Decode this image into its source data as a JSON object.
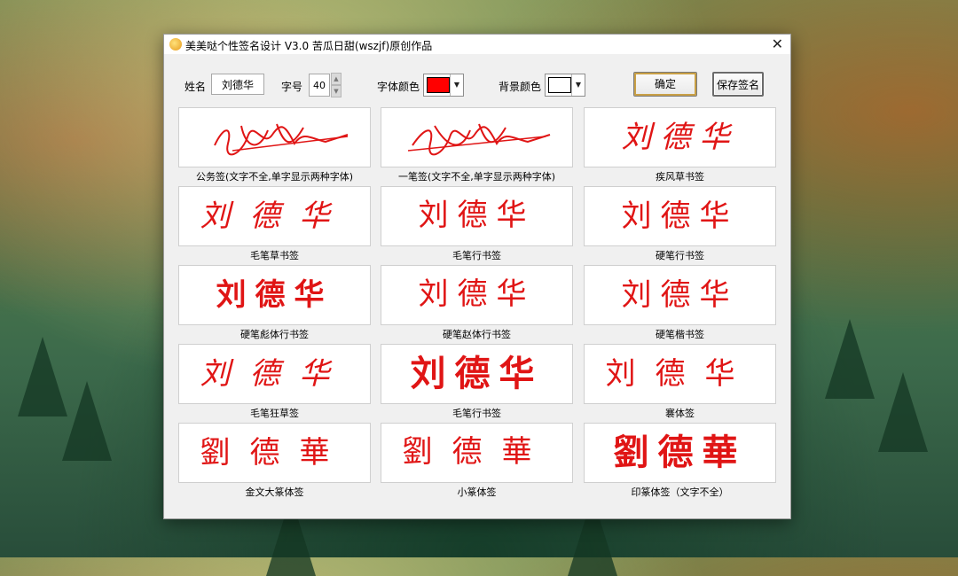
{
  "window": {
    "title": "美美哒个性签名设计 V3.0   苦瓜日甜(wszjf)原创作品",
    "close_glyph": "✕"
  },
  "toolbar": {
    "name_label": "姓名",
    "name_value": "刘德华",
    "size_label": "字号",
    "size_value": "40",
    "font_color_label": "字体颜色",
    "font_color": "#ff0000",
    "bg_color_label": "背景颜色",
    "bg_color": "#ffffff",
    "confirm_button": "确定",
    "save_button": "保存签名"
  },
  "signature_color": "#e01515",
  "panels": [
    {
      "caption": "公务签(文字不全,单字显示两种字体)"
    },
    {
      "caption": "一笔签(文字不全,单字显示两种字体)"
    },
    {
      "caption": "疾风草书签",
      "text": "刘德华"
    },
    {
      "caption": "毛笔草书签",
      "text": "刘德华"
    },
    {
      "caption": "毛笔行书签",
      "text": "刘德华"
    },
    {
      "caption": "硬笔行书签",
      "text": "刘德华"
    },
    {
      "caption": "硬笔彪体行书签",
      "text": "刘德华"
    },
    {
      "caption": "硬笔赵体行书签",
      "text": "刘德华"
    },
    {
      "caption": "硬笔楷书签",
      "text": "刘德华"
    },
    {
      "caption": "毛笔狂草签",
      "text": "刘德华"
    },
    {
      "caption": "毛笔行书签",
      "text": "刘德华"
    },
    {
      "caption": "褰体签",
      "text": "刘德华"
    },
    {
      "caption": "金文大篆体签",
      "text": "劉德華"
    },
    {
      "caption": "小篆体签",
      "text": "劉德華"
    },
    {
      "caption": "印篆体签（文字不全）",
      "text": "劉德華"
    }
  ]
}
